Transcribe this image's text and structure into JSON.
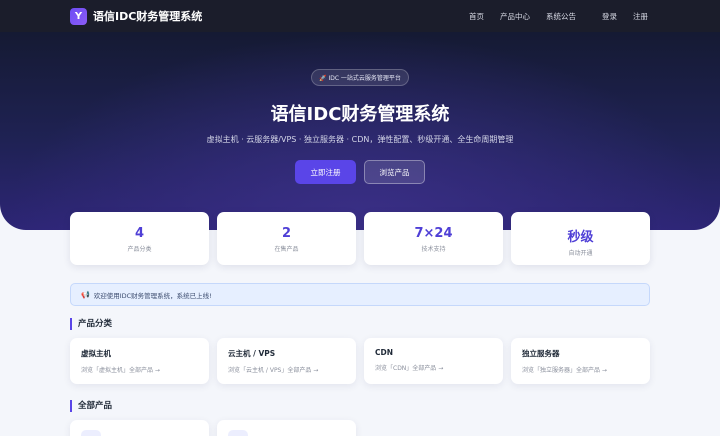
{
  "nav": {
    "logo_letter": "Y",
    "brand": "语信IDC财务管理系统",
    "links": [
      "首页",
      "产品中心",
      "系统公告",
      "登录",
      "注册"
    ]
  },
  "hero": {
    "badge": "🚀 IDC 一站式云服务管理平台",
    "title": "语信IDC财务管理系统",
    "subtitle": "虚拟主机 · 云服务器/VPS · 独立服务器 · CDN，弹性配置、秒级开通、全生命周期管理",
    "primary_button": "立即注册",
    "secondary_button": "浏览产品"
  },
  "stats": [
    {
      "value": "4",
      "label": "产品分类"
    },
    {
      "value": "2",
      "label": "在售产品"
    },
    {
      "value": "7×24",
      "label": "技术支持"
    },
    {
      "value": "秒级",
      "label": "自动开通"
    }
  ],
  "notice": {
    "flag": "📢",
    "text": "欢迎使用IDC财务管理系统，系统已上线!"
  },
  "categories_section": {
    "title": "产品分类",
    "items": [
      {
        "name": "虚拟主机",
        "link": "浏览「虚拟主机」全部产品 →"
      },
      {
        "name": "云主机 / VPS",
        "link": "浏览「云主机 / VPS」全部产品 →"
      },
      {
        "name": "CDN",
        "link": "浏览「CDN」全部产品 →"
      },
      {
        "name": "独立服务器",
        "link": "浏览「独立服务器」全部产品 →"
      }
    ]
  },
  "products_section": {
    "title": "全部产品"
  },
  "colors": {
    "accent": "#5a45e8",
    "nav_bg": "#1b1d2b",
    "hero_bg": "#1f2254",
    "notice_bg": "#e6efff"
  }
}
